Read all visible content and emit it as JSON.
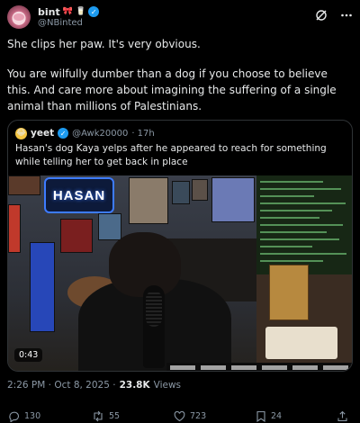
{
  "author": {
    "display_name": "bint",
    "handle": "@NBinted",
    "emoji_1": "🎀",
    "emoji_2": "🥛",
    "verified_mark": "✓"
  },
  "header_icons": [
    "grok-icon",
    "more-icon"
  ],
  "tweet": {
    "paragraph_1": "She clips her paw. It's very obvious.",
    "paragraph_2": "You are wilfully dumber than a dog if you choose to believe this. And care more about imagining the suffering of a single animal than millions of Palestinians."
  },
  "quoted_tweet": {
    "avatar_emoji": "😂",
    "display_name": "yeet",
    "verified_mark": "✓",
    "handle": "@Awk20000",
    "time": "· 17h",
    "text": "Hasan's dog Kaya yelps after he appeared to reach for something while telling her to get back in place",
    "video": {
      "sign_text": "HASAN",
      "duration": "0:43"
    }
  },
  "meta": {
    "timestamp": "2:26 PM · Oct 8, 2025 ·",
    "views_count": "23.8K",
    "views_label": "Views"
  },
  "actions": {
    "replies": "130",
    "reposts": "55",
    "likes": "723",
    "bookmarks": "24"
  },
  "colors": {
    "background": "#000000",
    "text": "#e7e9ea",
    "muted": "#8b98a5",
    "verified": "#1d9bf0",
    "border": "#2f3336"
  }
}
